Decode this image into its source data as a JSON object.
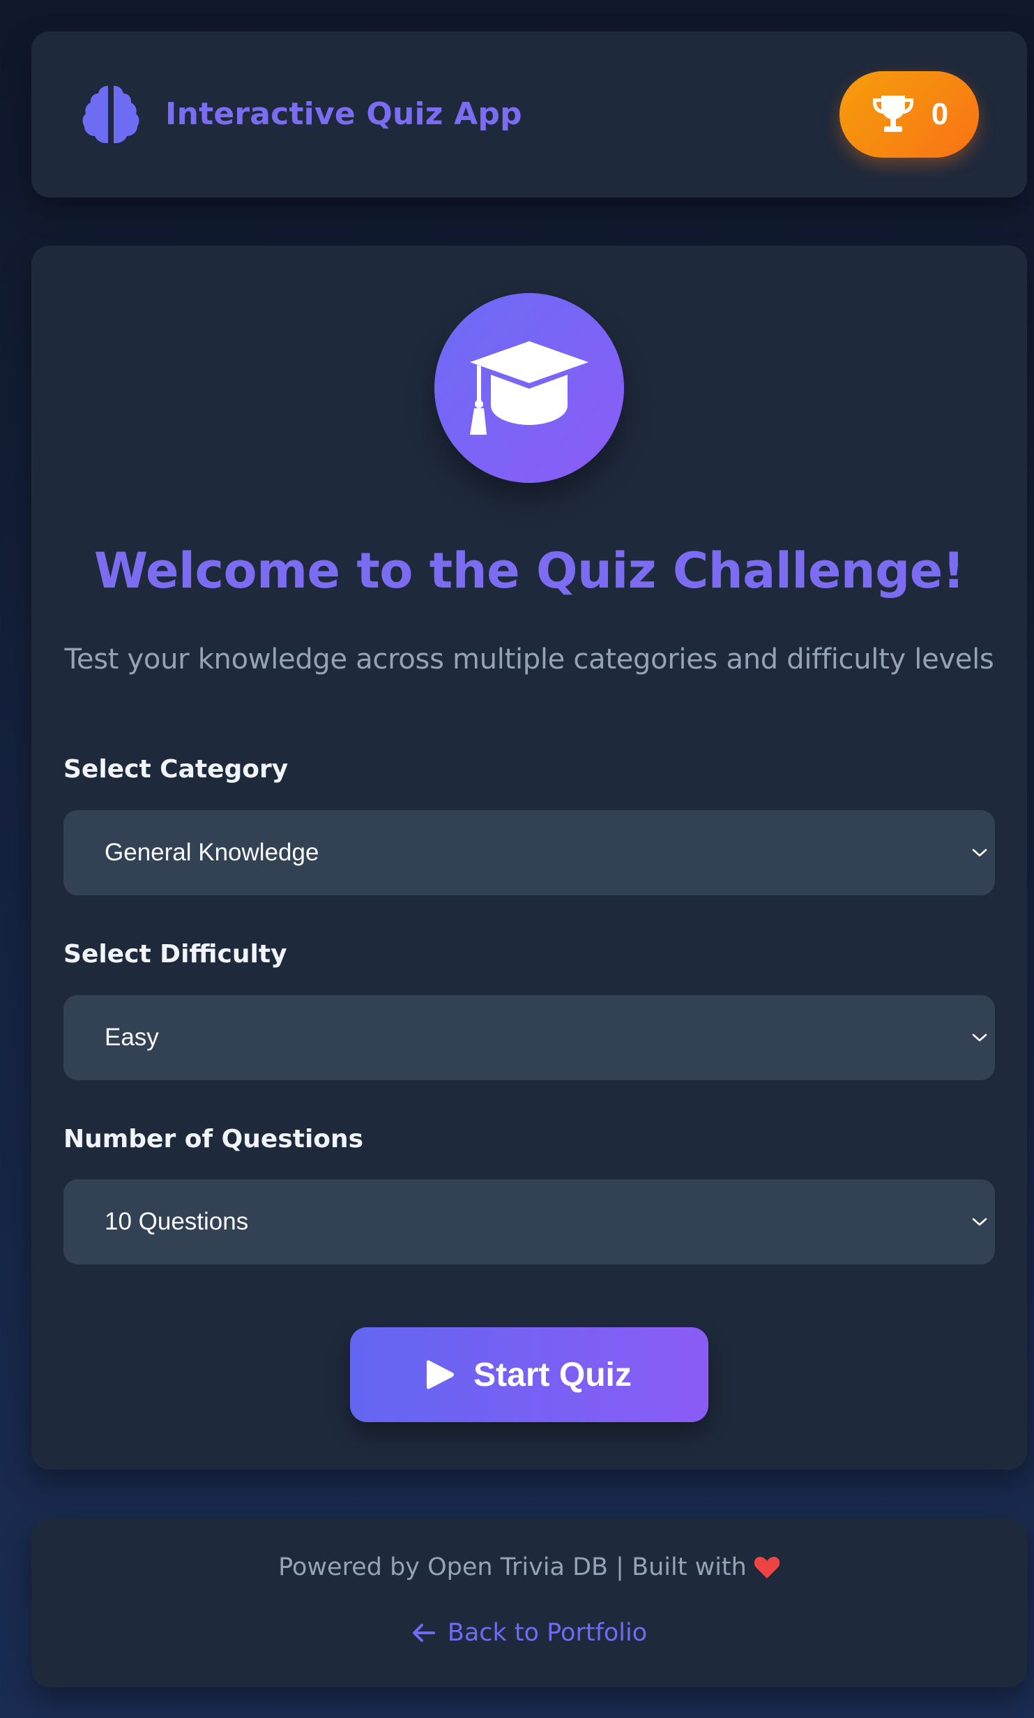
{
  "header": {
    "app_title": "Interactive Quiz App",
    "brand_icon": "brain-icon",
    "score_icon": "trophy-icon",
    "score": "0"
  },
  "hero": {
    "icon": "graduation-cap-icon",
    "title": "Welcome to the Quiz Challenge!",
    "subtitle": "Test your knowledge across multiple categories and difficulty levels"
  },
  "form": {
    "category": {
      "label": "Select Category",
      "selected": "General Knowledge"
    },
    "difficulty": {
      "label": "Select Difficulty",
      "selected": "Easy"
    },
    "questions": {
      "label": "Number of Questions",
      "selected": "10 Questions"
    },
    "start_button": {
      "label": "Start Quiz",
      "icon": "play-icon"
    }
  },
  "footer": {
    "credits": "Powered by Open Trivia DB | Built with",
    "heart_icon": "heart-icon",
    "back_link": "Back to Portfolio",
    "back_icon": "arrow-left-icon"
  },
  "colors": {
    "accent": "#7c6cf2",
    "card": "#1e293b",
    "input": "#334155",
    "badge_start": "#f59e0b",
    "badge_end": "#f97316",
    "heart": "#ef4444"
  }
}
